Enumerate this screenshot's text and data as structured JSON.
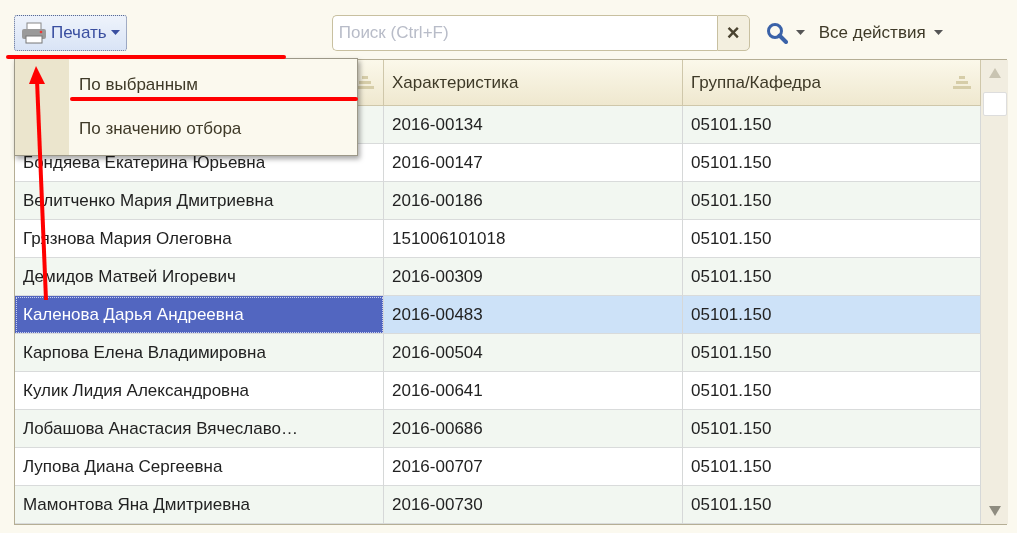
{
  "toolbar": {
    "print_button": "Печать",
    "search": {
      "placeholder": "Поиск (Ctrl+F)"
    },
    "clear_button": "×",
    "all_actions": "Все действия"
  },
  "print_menu": {
    "items": [
      {
        "label": "По выбранным"
      },
      {
        "label": "По значению отбора"
      }
    ]
  },
  "table": {
    "columns": [
      {
        "sortable": true
      },
      {
        "label": "Характеристика",
        "sortable": false
      },
      {
        "label": "Группа/Кафедра",
        "sortable": true
      }
    ],
    "rows": [
      {
        "characteristic": "2016-00134",
        "group": "05101.150",
        "selected": false
      },
      {
        "name": "Бондяева Екатерина Юрьевна",
        "characteristic": "2016-00147",
        "group": "05101.150",
        "selected": false
      },
      {
        "name": "Велитченко Мария Дмитриевна",
        "characteristic": "2016-00186",
        "group": "05101.150",
        "selected": false
      },
      {
        "name": "Грязнова Мария Олеговна",
        "characteristic": "151006101018",
        "group": "05101.150",
        "selected": false
      },
      {
        "name": "Демидов Матвей Игоревич",
        "characteristic": "2016-00309",
        "group": "05101.150",
        "selected": false
      },
      {
        "name": "Каленова Дарья Андреевна",
        "characteristic": "2016-00483",
        "group": "05101.150",
        "selected": true
      },
      {
        "name": "Карпова Елена Владимировна",
        "characteristic": "2016-00504",
        "group": "05101.150",
        "selected": false
      },
      {
        "name": "Кулик Лидия Александровна",
        "characteristic": "2016-00641",
        "group": "05101.150",
        "selected": false
      },
      {
        "name": "Лобашова Анастасия Вячеславо…",
        "characteristic": "2016-00686",
        "group": "05101.150",
        "selected": false
      },
      {
        "name": "Лупова Диана Сергеевна",
        "characteristic": "2016-00707",
        "group": "05101.150",
        "selected": false
      },
      {
        "name": "Мамонтова Яна Дмитриевна",
        "characteristic": "2016-00730",
        "group": "05101.150",
        "selected": false
      }
    ]
  }
}
